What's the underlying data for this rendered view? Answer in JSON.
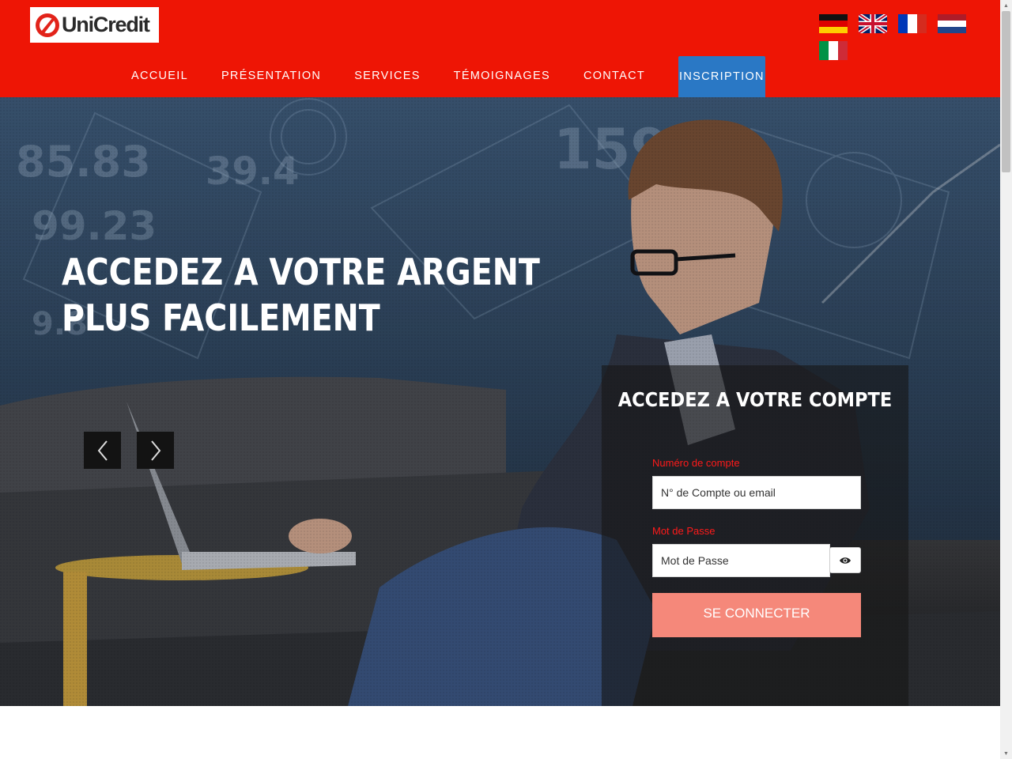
{
  "header": {
    "logo_text": "UniCredit",
    "brand_color": "#ee1505",
    "nav": [
      {
        "label": "ACCUEIL"
      },
      {
        "label": "PRÉSENTATION"
      },
      {
        "label": "SERVICES"
      },
      {
        "label": "TÉMOIGNAGES"
      },
      {
        "label": "CONTACT"
      },
      {
        "label": "INSCRIPTION",
        "active": true
      }
    ],
    "active_color": "#2a78c5",
    "flags": [
      "flag-germany-icon",
      "flag-uk-icon",
      "flag-france-icon",
      "flag-netherlands-icon",
      "flag-italy-icon"
    ]
  },
  "hero": {
    "title": "ACCEDEZ A VOTRE ARGENT PLUS FACILEMENT",
    "prev_icon": "chevron-left-icon",
    "next_icon": "chevron-right-icon"
  },
  "login": {
    "title": "ACCEDEZ A VOTRE COMPTE",
    "account_label": "Numéro de compte",
    "account_placeholder": "N° de Compte ou email",
    "password_label": "Mot de Passe",
    "password_placeholder": "Mot de Passe",
    "toggle_icon": "eye-icon",
    "submit_label": "SE CONNECTER",
    "submit_color": "#f5887a",
    "label_color": "#ff1a1a"
  }
}
